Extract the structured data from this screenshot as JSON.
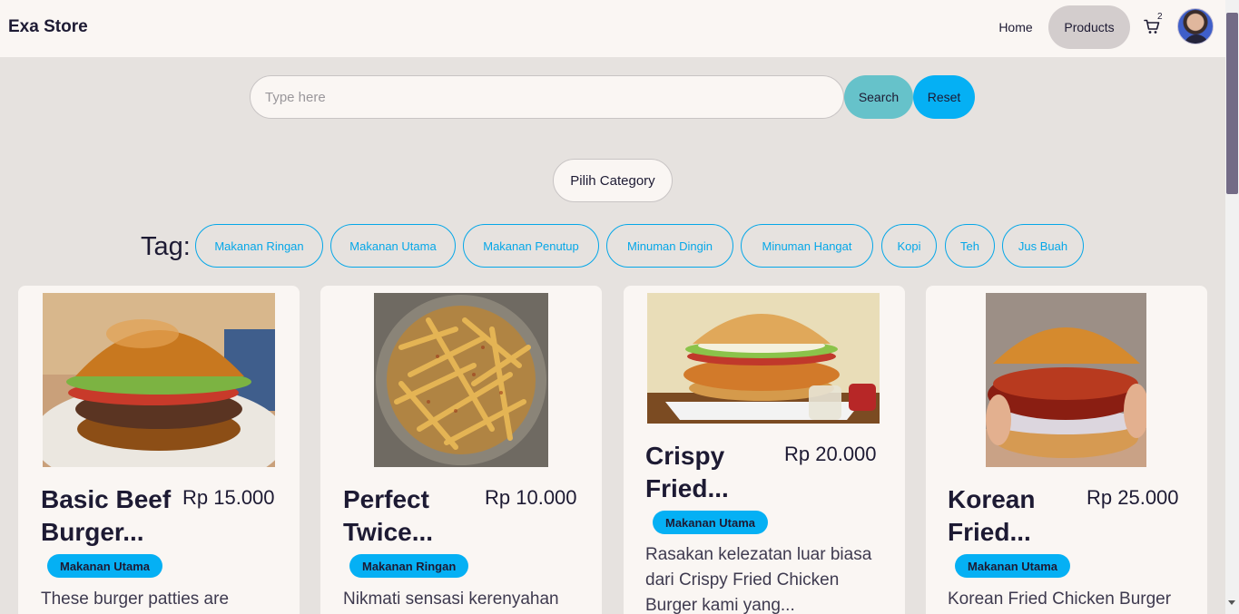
{
  "navbar": {
    "brand": "Exa Store",
    "links": [
      "Home",
      "Products"
    ],
    "cart_count": "2"
  },
  "search": {
    "placeholder": "Type here",
    "search_label": "Search",
    "reset_label": "Reset"
  },
  "category": {
    "label": "Pilih Category"
  },
  "tags": {
    "label": "Tag:",
    "items": [
      "Makanan Ringan",
      "Makanan Utama",
      "Makanan Penutup",
      "Minuman Dingin",
      "Minuman Hangat",
      "Kopi",
      "Teh",
      "Jus Buah"
    ]
  },
  "products": [
    {
      "title": "Basic Beef Burger...",
      "price": "Rp 15.000",
      "badge": "Makanan Utama",
      "description": "These burger patties are",
      "image": "burger-image"
    },
    {
      "title": "Perfect Twice...",
      "price": "Rp 10.000",
      "badge": "Makanan Ringan",
      "description": "Nikmati sensasi kerenyahan",
      "image": "fries-image"
    },
    {
      "title": "Crispy Fried...",
      "price": "Rp 20.000",
      "badge": "Makanan Utama",
      "description": "Rasakan kelezatan luar biasa dari Crispy Fried Chicken Burger kami yang...",
      "image": "chicken-burger-image"
    },
    {
      "title": "Korean Fried...",
      "price": "Rp 25.000",
      "badge": "Makanan Utama",
      "description": "Korean Fried Chicken Burger",
      "image": "korean-burger-image"
    }
  ],
  "colors": {
    "accent": "#05b0f4",
    "search_button": "#66c2ca",
    "background": "#e6e2df",
    "surface": "#faf6f3",
    "text": "#1d1a33"
  }
}
